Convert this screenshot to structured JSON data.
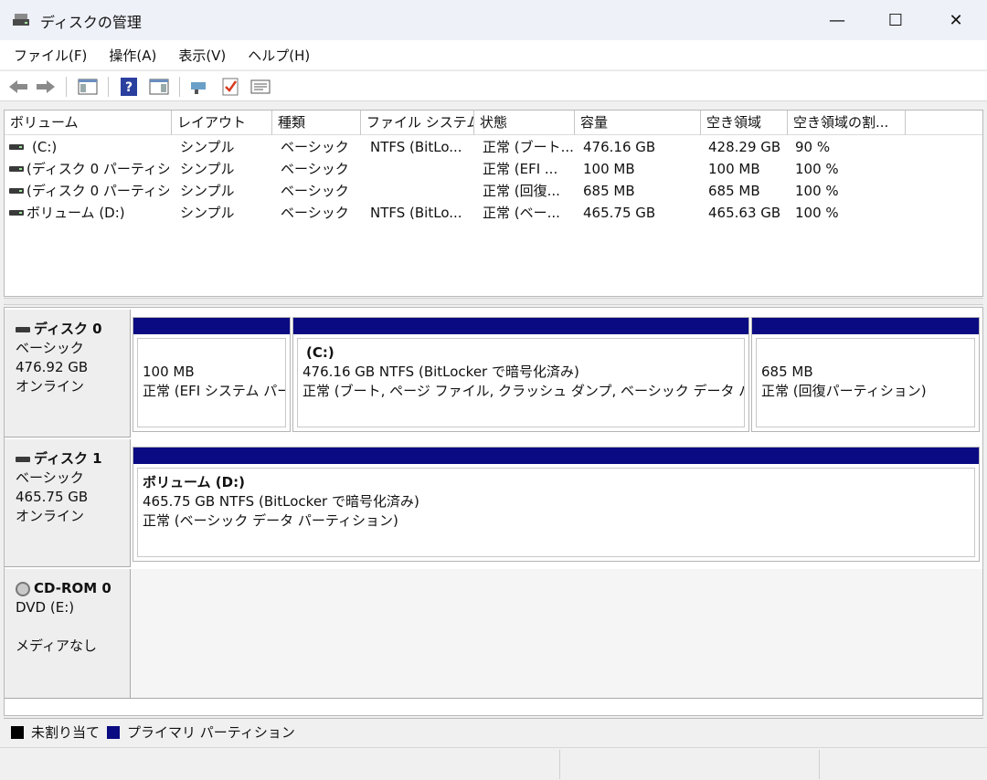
{
  "window": {
    "title": "ディスクの管理",
    "minimize_glyph": "—",
    "maximize_glyph": "☐",
    "close_glyph": "✕"
  },
  "menu": [
    "ファイル(F)",
    "操作(A)",
    "表示(V)",
    "ヘルプ(H)"
  ],
  "toolbar": {
    "icons": [
      "back-arrow-icon",
      "forward-arrow-icon",
      "show-hide-tree-icon",
      "help-icon",
      "show-action-pane-icon",
      "connect-icon",
      "check-icon",
      "properties-icon"
    ]
  },
  "volume_list": {
    "columns": [
      "ボリューム",
      "レイアウト",
      "種類",
      "ファイル システム",
      "状態",
      "容量",
      "空き領域",
      "空き領域の割..."
    ],
    "rows": [
      [
        "(C:)",
        "シンプル",
        "ベーシック",
        "NTFS (BitLo...",
        "正常 (ブート...",
        "476.16 GB",
        "428.29 GB",
        "90 %"
      ],
      [
        "(ディスク 0 パーティシ...",
        "シンプル",
        "ベーシック",
        "",
        "正常 (EFI ...",
        "100 MB",
        "100 MB",
        "100 %"
      ],
      [
        "(ディスク 0 パーティシ...",
        "シンプル",
        "ベーシック",
        "",
        "正常 (回復...",
        "685 MB",
        "685 MB",
        "100 %"
      ],
      [
        "ボリューム (D:)",
        "シンプル",
        "ベーシック",
        "NTFS (BitLo...",
        "正常 (ベー...",
        "465.75 GB",
        "465.63 GB",
        "100 %"
      ]
    ]
  },
  "disks": [
    {
      "name": "ディスク 0",
      "type": "ベーシック",
      "size": "476.92 GB",
      "status": "オンライン",
      "partitions": [
        {
          "title": "",
          "line1": "100 MB",
          "line2": "正常 (EFI システム パー"
        },
        {
          "title": "(C:)",
          "line1": "476.16 GB NTFS (BitLocker で暗号化済み)",
          "line2": "正常 (ブート, ページ ファイル, クラッシュ ダンプ, ベーシック データ パーティシ"
        },
        {
          "title": "",
          "line1": "685 MB",
          "line2": "正常 (回復パーティション)"
        }
      ]
    },
    {
      "name": "ディスク 1",
      "type": "ベーシック",
      "size": "465.75 GB",
      "status": "オンライン",
      "partitions": [
        {
          "title": "ボリューム  (D:)",
          "line1": "465.75 GB NTFS (BitLocker で暗号化済み)",
          "line2": "正常 (ベーシック データ パーティション)"
        }
      ]
    }
  ],
  "cdrom": {
    "name": "CD-ROM 0",
    "type": "DVD (E:)",
    "status": "メディアなし"
  },
  "legend": {
    "unallocated_label": "未割り当て",
    "unallocated_color": "#000000",
    "primary_label": "プライマリ パーティション",
    "primary_color": "#0a0a82"
  }
}
